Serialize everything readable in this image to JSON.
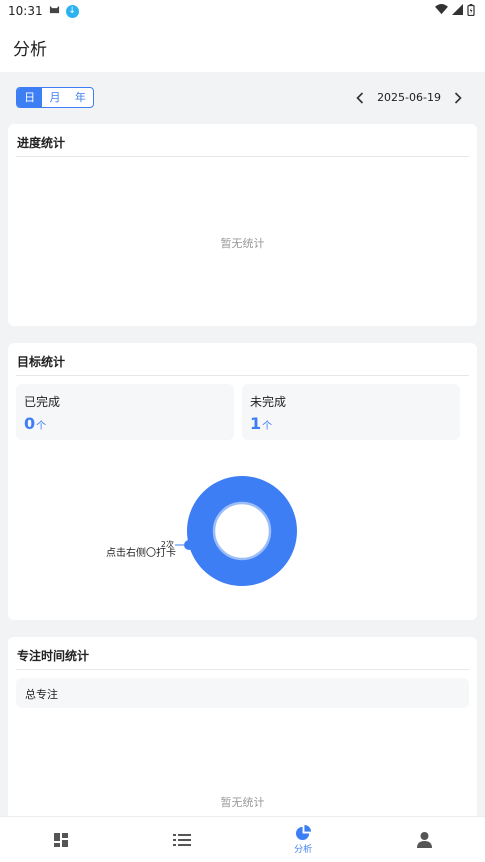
{
  "status_bar": {
    "time": "10:31"
  },
  "app_bar": {
    "title": "分析"
  },
  "filter": {
    "segments": [
      "日",
      "月",
      "年"
    ],
    "selected": "日",
    "date": "2025-06-19"
  },
  "progress_card": {
    "title": "进度统计",
    "empty_text": "暂无统计"
  },
  "goal_card": {
    "title": "目标统计",
    "completed": {
      "label": "已完成",
      "value": "0",
      "unit": "个"
    },
    "uncompleted": {
      "label": "未完成",
      "value": "1",
      "unit": "个"
    }
  },
  "chart_data": {
    "type": "pie",
    "categories": [
      "点击右侧〇打卡"
    ],
    "values": [
      2
    ],
    "data_labels": [
      "2次"
    ],
    "colors": [
      "#3d7ef5"
    ]
  },
  "focus_card": {
    "title": "专注时间统计",
    "total_label": "总专注",
    "empty_text": "暂无统计"
  },
  "bottom_nav": {
    "items": [
      {
        "icon": "dashboard-icon",
        "label": ""
      },
      {
        "icon": "list-icon",
        "label": ""
      },
      {
        "icon": "pie-chart-icon",
        "label": "分析"
      },
      {
        "icon": "person-icon",
        "label": ""
      }
    ],
    "active_color": "#3d7ef5",
    "inactive_color": "#555555"
  }
}
